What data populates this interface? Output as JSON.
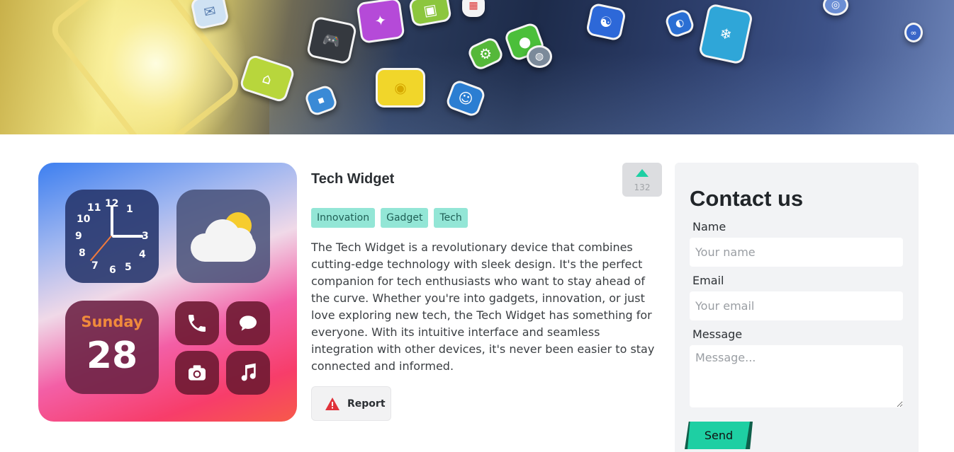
{
  "banner": {
    "icons": [
      "mail-icon",
      "gamepad-icon",
      "shapes-icon",
      "calendar-icon",
      "snowflake-icon",
      "wifi-icon",
      "settings-icon",
      "globe-icon",
      "weather-icon"
    ]
  },
  "product": {
    "title": "Tech Widget",
    "votes": "132",
    "tags": [
      "Innovation",
      "Gadget",
      "Tech"
    ],
    "description": "The Tech Widget is a revolutionary device that combines cutting-edge technology with sleek design. It's the perfect companion for tech enthusiasts who want to stay ahead of the curve. Whether you're into gadgets, innovation, or just love exploring new tech, the Tech Widget has something for everyone. With its intuitive interface and seamless integration with other devices, it's never been easier to stay connected and informed.",
    "report_label": "Report",
    "image": {
      "clock_numbers": [
        "12",
        "1",
        "3",
        "4",
        "5",
        "6",
        "7",
        "8",
        "9",
        "10",
        "11"
      ],
      "date_day": "Sunday",
      "date_number": "28"
    }
  },
  "contact": {
    "heading": "Contact us",
    "name_label": "Name",
    "name_placeholder": "Your name",
    "email_label": "Email",
    "email_placeholder": "Your email",
    "message_label": "Message",
    "message_placeholder": "Message...",
    "send_label": "Send"
  },
  "colors": {
    "accent": "#1ecfa3",
    "tag_bg": "#93e6d6",
    "report_icon": "#e0323a"
  }
}
